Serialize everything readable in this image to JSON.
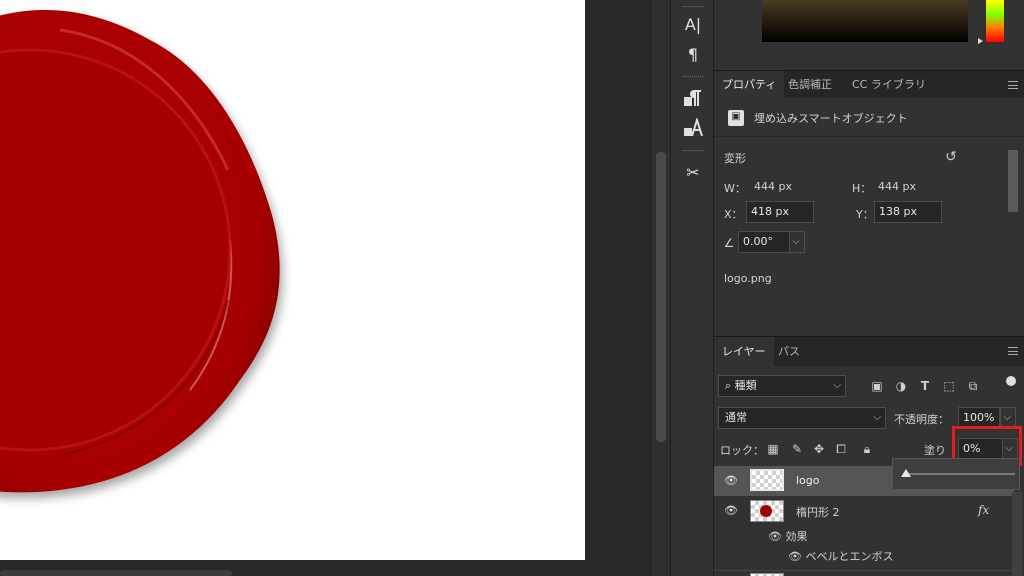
{
  "tools": [
    {
      "icon": "vertical-type-icon",
      "glyph": "A|"
    },
    {
      "icon": "paragraph-icon",
      "glyph": "¶"
    },
    {
      "icon": "paragraph-style-icon",
      "glyph": "⁋"
    },
    {
      "icon": "character-style-icon",
      "glyph": "A"
    },
    {
      "icon": "tools-icon",
      "glyph": "✂"
    }
  ],
  "properties_panel": {
    "tabs": [
      "プロパティ",
      "色調補正",
      "CC ライブラリ"
    ],
    "object_type": "埋め込みスマートオブジェクト",
    "transform_label": "変形",
    "w_label": "W：",
    "w_value": "444 px",
    "h_label": "H：",
    "h_value": "444 px",
    "x_label": "X：",
    "x_value": "418 px",
    "y_label": "Y：",
    "y_value": "138 px",
    "angle_value": "0.00°",
    "filename": "logo.png"
  },
  "layers_panel": {
    "tabs": [
      "レイヤー",
      "パス"
    ],
    "filter_kind": "種類",
    "blend_mode": "通常",
    "opacity_label": "不透明度：",
    "opacity_value": "100%",
    "lock_label": "ロック：",
    "fill_label": "塗り",
    "fill_value": "0%",
    "layers": [
      {
        "name": "logo",
        "selected": true
      },
      {
        "name": "楕円形 2",
        "fx": "fx"
      }
    ],
    "effects_label": "効果",
    "effect_item": "ベベルとエンボス"
  },
  "colors": {
    "seal_red": "#b00000",
    "highlight_red": "#e02020",
    "panel_bg": "#323232"
  }
}
